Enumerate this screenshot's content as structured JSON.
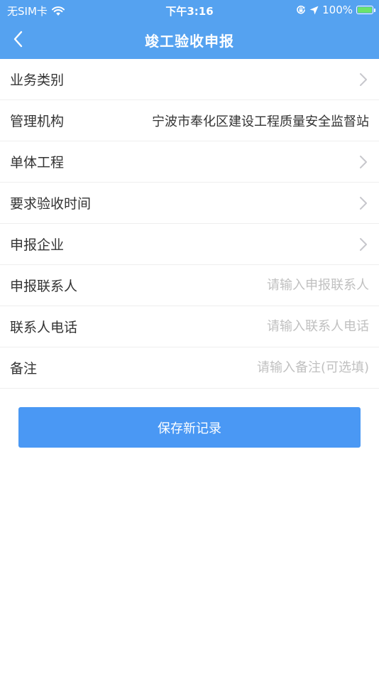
{
  "status_bar": {
    "carrier": "无SIM卡",
    "time": "下午3:16",
    "battery_percent": "100%",
    "battery_level": 1.0,
    "icons": [
      "wifi-icon",
      "orientation-lock-icon",
      "location-arrow-icon",
      "battery-icon"
    ]
  },
  "nav": {
    "title": "竣工验收申报",
    "back_icon": "chevron-left-icon"
  },
  "form": {
    "business_type": {
      "label": "业务类别"
    },
    "management_org": {
      "label": "管理机构",
      "value": "宁波市奉化区建设工程质量安全监督站"
    },
    "unit_project": {
      "label": "单体工程"
    },
    "acceptance_time": {
      "label": "要求验收时间"
    },
    "applicant_company": {
      "label": "申报企业"
    },
    "contact_person": {
      "label": "申报联系人",
      "value": "",
      "placeholder": "请输入申报联系人"
    },
    "contact_phone": {
      "label": "联系人电话",
      "value": "",
      "placeholder": "请输入联系人电话"
    },
    "remarks": {
      "label": "备注",
      "value": "",
      "placeholder": "请输入备注(可选填)"
    }
  },
  "actions": {
    "save_label": "保存新记录"
  },
  "colors": {
    "header_bg": "#55A2F0",
    "button_bg": "#4A98F4",
    "divider": "#EEEEEE",
    "placeholder": "#C0C0C0",
    "chevron": "#C7C7CC",
    "battery_fill": "#6BE36B"
  }
}
